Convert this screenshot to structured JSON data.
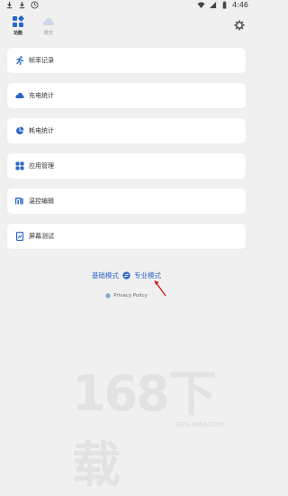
{
  "statusbar": {
    "time": "4:46"
  },
  "nav": {
    "feature_label": "功能",
    "about_label": "概览"
  },
  "menu": [
    {
      "label": "帧率记录",
      "icon": "run-icon"
    },
    {
      "label": "充电统计",
      "icon": "charge-icon"
    },
    {
      "label": "耗电统计",
      "icon": "pie-chart-icon"
    },
    {
      "label": "应用管理",
      "icon": "grid-icon"
    },
    {
      "label": "温控编辑",
      "icon": "mi-icon"
    },
    {
      "label": "屏幕测试",
      "icon": "screen-test-icon"
    }
  ],
  "mode": {
    "basic": "基础模式",
    "pro": "专业模式"
  },
  "policy": "Privacy Policy",
  "watermark": {
    "big": "168下载",
    "small": "GPS.I6I68.COM"
  },
  "colors": {
    "accent": "#2a66c8",
    "arrow": "#d01010"
  }
}
